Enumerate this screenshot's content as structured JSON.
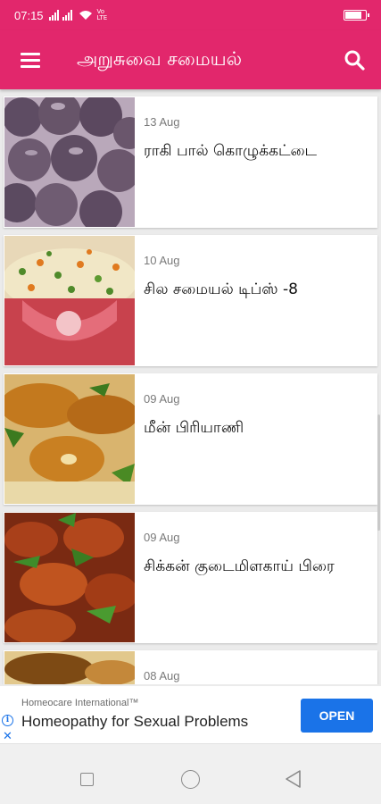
{
  "status_bar": {
    "time": "07:15",
    "signal_text": "Vo LTE",
    "battery_level": 0.85
  },
  "app_bar": {
    "title": "அறுசுவை சமையல்",
    "menu_icon": "hamburger-menu-icon",
    "search_icon": "search-icon"
  },
  "articles": [
    {
      "date": "13 Aug",
      "title": "ராகி பால் கொழுக்கட்டை",
      "thumbnail": "ragi-dumplings-photo"
    },
    {
      "date": "10 Aug",
      "title": "சில சமையல் டிப்ஸ் -8",
      "thumbnail": "vegetable-rice-photo"
    },
    {
      "date": "09 Aug",
      "title": "மீன் பிரியாணி",
      "thumbnail": "fish-biryani-photo"
    },
    {
      "date": "09 Aug",
      "title": "சிக்கன் குடைமிளகாய் பிரை",
      "thumbnail": "chicken-capsicum-fry-photo"
    },
    {
      "date": "08 Aug",
      "title": "",
      "thumbnail": "food-photo"
    }
  ],
  "ad": {
    "sponsor": "Homeocare International™",
    "headline": "Homeopathy for Sexual Problems",
    "cta": "OPEN",
    "info_icon": "ad-info-icon",
    "close_icon": "ad-close-icon",
    "cta_color": "#1a73e8"
  },
  "nav_bar": {
    "recents_icon": "recents-square-icon",
    "home_icon": "home-circle-icon",
    "back_icon": "back-triangle-icon"
  },
  "colors": {
    "primary": "#e2276c",
    "background": "#ebebeb",
    "card": "#ffffff"
  }
}
